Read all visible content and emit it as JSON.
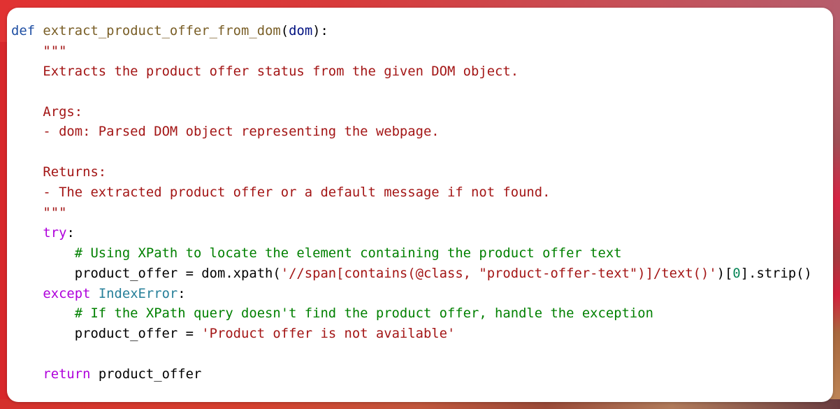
{
  "code": {
    "language": "python",
    "lines": [
      [
        {
          "t": "def",
          "c": "kw-def"
        },
        {
          "t": " ",
          "c": ""
        },
        {
          "t": "extract_product_offer_from_dom",
          "c": "fn"
        },
        {
          "t": "(",
          "c": ""
        },
        {
          "t": "dom",
          "c": "param"
        },
        {
          "t": "):",
          "c": ""
        }
      ],
      [
        {
          "t": "    ",
          "c": ""
        },
        {
          "t": "\"\"\"",
          "c": "doc"
        }
      ],
      [
        {
          "t": "    ",
          "c": ""
        },
        {
          "t": "Extracts the product offer status from the given DOM object.",
          "c": "doc"
        }
      ],
      [
        {
          "t": "",
          "c": ""
        }
      ],
      [
        {
          "t": "    ",
          "c": ""
        },
        {
          "t": "Args:",
          "c": "doc"
        }
      ],
      [
        {
          "t": "    ",
          "c": ""
        },
        {
          "t": "- dom: Parsed DOM object representing the webpage.",
          "c": "doc"
        }
      ],
      [
        {
          "t": "",
          "c": ""
        }
      ],
      [
        {
          "t": "    ",
          "c": ""
        },
        {
          "t": "Returns:",
          "c": "doc"
        }
      ],
      [
        {
          "t": "    ",
          "c": ""
        },
        {
          "t": "- The extracted product offer or a default message if not found.",
          "c": "doc"
        }
      ],
      [
        {
          "t": "    ",
          "c": ""
        },
        {
          "t": "\"\"\"",
          "c": "doc"
        }
      ],
      [
        {
          "t": "    ",
          "c": ""
        },
        {
          "t": "try",
          "c": "ctl"
        },
        {
          "t": ":",
          "c": ""
        }
      ],
      [
        {
          "t": "        ",
          "c": ""
        },
        {
          "t": "# Using XPath to locate the element containing the product offer text",
          "c": "cmt"
        }
      ],
      [
        {
          "t": "        ",
          "c": ""
        },
        {
          "t": "product_offer = dom.xpath(",
          "c": ""
        },
        {
          "t": "'//span[contains(@class, \"product-offer-text\")]/text()'",
          "c": "str"
        },
        {
          "t": ")[",
          "c": ""
        },
        {
          "t": "0",
          "c": "num"
        },
        {
          "t": "].strip()",
          "c": ""
        }
      ],
      [
        {
          "t": "    ",
          "c": ""
        },
        {
          "t": "except",
          "c": "ctl"
        },
        {
          "t": " ",
          "c": ""
        },
        {
          "t": "IndexError",
          "c": "cls"
        },
        {
          "t": ":",
          "c": ""
        }
      ],
      [
        {
          "t": "        ",
          "c": ""
        },
        {
          "t": "# If the XPath query doesn't find the product offer, handle the exception",
          "c": "cmt"
        }
      ],
      [
        {
          "t": "        ",
          "c": ""
        },
        {
          "t": "product_offer = ",
          "c": ""
        },
        {
          "t": "'Product offer is not available'",
          "c": "str"
        }
      ],
      [
        {
          "t": "",
          "c": ""
        }
      ],
      [
        {
          "t": "    ",
          "c": ""
        },
        {
          "t": "return",
          "c": "ctl"
        },
        {
          "t": " product_offer",
          "c": ""
        }
      ]
    ]
  },
  "colors": {
    "card_background": "#ffffff",
    "keyword_def": "#1f4fa3",
    "function_name": "#795e26",
    "parameter": "#001080",
    "string": "#a31515",
    "comment": "#008000",
    "control_keyword": "#af00db",
    "class_name": "#267f99",
    "number": "#098658",
    "default_text": "#000000"
  }
}
